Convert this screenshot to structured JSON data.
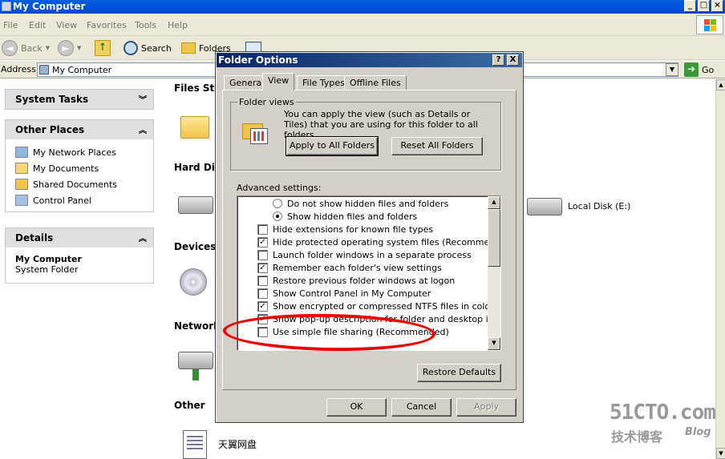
{
  "window": {
    "title": "My Computer"
  },
  "menu": [
    "File",
    "Edit",
    "View",
    "Favorites",
    "Tools",
    "Help"
  ],
  "toolbar": {
    "back": "Back",
    "search": "Search",
    "folders": "Folders"
  },
  "address": {
    "label": "Address",
    "value": "My Computer",
    "go": "Go"
  },
  "sidebar": {
    "system_tasks": "System Tasks",
    "other_places": {
      "title": "Other Places",
      "items": [
        "My Network Places",
        "My Documents",
        "Shared Documents",
        "Control Panel"
      ]
    },
    "details": {
      "title": "Details",
      "name": "My Computer",
      "type": "System Folder"
    }
  },
  "content": {
    "files_stored": "Files Stor",
    "hard_disk": "Hard Disk",
    "devices": "Devices v",
    "network": "Network",
    "other": "Other",
    "local_disk_e": "Local Disk (E:)",
    "other_item": "天翼网盘"
  },
  "dialog": {
    "title": "Folder Options",
    "help_btn": "?",
    "close_btn": "X",
    "tabs": [
      "General",
      "View",
      "File Types",
      "Offline Files"
    ],
    "folder_views": {
      "legend": "Folder views",
      "description": "You can apply the view (such as Details or Tiles) that you are using for this folder to all folders.",
      "apply_all": "Apply to All Folders",
      "reset_all": "Reset All Folders"
    },
    "advanced_label": "Advanced settings:",
    "settings": [
      {
        "label": "Do not show hidden files and folders",
        "kind": "radio",
        "checked": false,
        "indent": true
      },
      {
        "label": "Show hidden files and folders",
        "kind": "radio",
        "checked": true,
        "indent": true
      },
      {
        "label": "Hide extensions for known file types",
        "kind": "check",
        "checked": false
      },
      {
        "label": "Hide protected operating system files (Recommended)",
        "kind": "check",
        "checked": true
      },
      {
        "label": "Launch folder windows in a separate process",
        "kind": "check",
        "checked": false
      },
      {
        "label": "Remember each folder's view settings",
        "kind": "check",
        "checked": true
      },
      {
        "label": "Restore previous folder windows at logon",
        "kind": "check",
        "checked": false
      },
      {
        "label": "Show Control Panel in My Computer",
        "kind": "check",
        "checked": false
      },
      {
        "label": "Show encrypted or compressed NTFS files in color",
        "kind": "check",
        "checked": true
      },
      {
        "label": "Show pop-up description for folder and desktop items",
        "kind": "check",
        "checked": true
      },
      {
        "label": "Use simple file sharing (Recommended)",
        "kind": "check",
        "checked": false
      }
    ],
    "restore_defaults": "Restore Defaults",
    "ok": "OK",
    "cancel": "Cancel",
    "apply": "Apply"
  },
  "watermark": {
    "brand": "51CTO.com",
    "sub": "技术博客",
    "blog": "Blog"
  }
}
